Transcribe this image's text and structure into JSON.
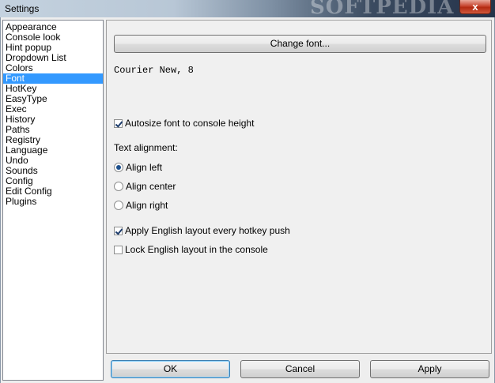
{
  "window": {
    "title": "Settings",
    "watermark": "SOFTPEDIA",
    "close_glyph": "x"
  },
  "sidebar": {
    "items": [
      {
        "label": "Appearance",
        "selected": false
      },
      {
        "label": "Console look",
        "selected": false
      },
      {
        "label": "Hint popup",
        "selected": false
      },
      {
        "label": "Dropdown List",
        "selected": false
      },
      {
        "label": "Colors",
        "selected": false
      },
      {
        "label": "Font",
        "selected": true
      },
      {
        "label": "HotKey",
        "selected": false
      },
      {
        "label": "EasyType",
        "selected": false
      },
      {
        "label": "Exec",
        "selected": false
      },
      {
        "label": "History",
        "selected": false
      },
      {
        "label": "Paths",
        "selected": false
      },
      {
        "label": "Registry",
        "selected": false
      },
      {
        "label": "Language",
        "selected": false
      },
      {
        "label": "Undo",
        "selected": false
      },
      {
        "label": "Sounds",
        "selected": false
      },
      {
        "label": "Config",
        "selected": false
      },
      {
        "label": "Edit Config",
        "selected": false
      },
      {
        "label": "Plugins",
        "selected": false
      }
    ]
  },
  "font_panel": {
    "change_font_label": "Change font...",
    "current_font": "Courier New, 8",
    "autosize_label": "Autosize font to console height",
    "autosize_checked": true,
    "text_alignment_label": "Text alignment:",
    "align_left_label": "Align left",
    "align_center_label": "Align center",
    "align_right_label": "Align right",
    "alignment_selected": "left",
    "apply_english_label": "Apply English layout every hotkey push",
    "apply_english_checked": true,
    "lock_english_label": "Lock English layout in the console",
    "lock_english_checked": false
  },
  "buttons": {
    "ok": "OK",
    "cancel": "Cancel",
    "apply": "Apply"
  }
}
